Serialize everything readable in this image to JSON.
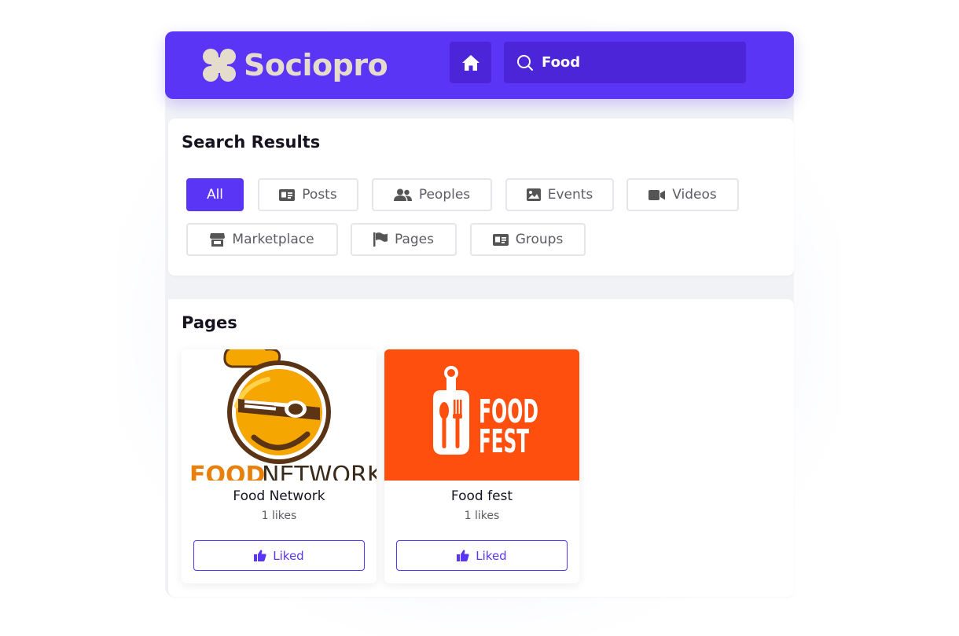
{
  "brand": {
    "name": "Sociopro",
    "accent": "#5b35f5",
    "logo_color": "#e6dccb"
  },
  "header": {
    "home_icon": "home-icon",
    "search": {
      "value": "Food",
      "icon": "search-icon"
    }
  },
  "search_results": {
    "title": "Search Results",
    "filters": [
      {
        "label": "All",
        "icon": "",
        "active": true
      },
      {
        "label": "Posts",
        "icon": "id-card-icon",
        "active": false
      },
      {
        "label": "Peoples",
        "icon": "users-icon",
        "active": false
      },
      {
        "label": "Events",
        "icon": "image-icon",
        "active": false
      },
      {
        "label": "Videos",
        "icon": "video-camera-icon",
        "active": false
      },
      {
        "label": "Marketplace",
        "icon": "store-icon",
        "active": false
      },
      {
        "label": "Pages",
        "icon": "flag-icon",
        "active": false
      },
      {
        "label": "Groups",
        "icon": "id-card-icon",
        "active": false
      }
    ]
  },
  "pages": {
    "title": "Pages",
    "items": [
      {
        "name": "Food Network",
        "likes": "1 likes",
        "button": "Liked",
        "cover_text": "FOOD NETWORK"
      },
      {
        "name": "Food fest",
        "likes": "1 likes",
        "button": "Liked",
        "cover_text_1": "FOOD",
        "cover_text_2": "FEST",
        "cover_color": "#ff4f0f"
      }
    ]
  }
}
